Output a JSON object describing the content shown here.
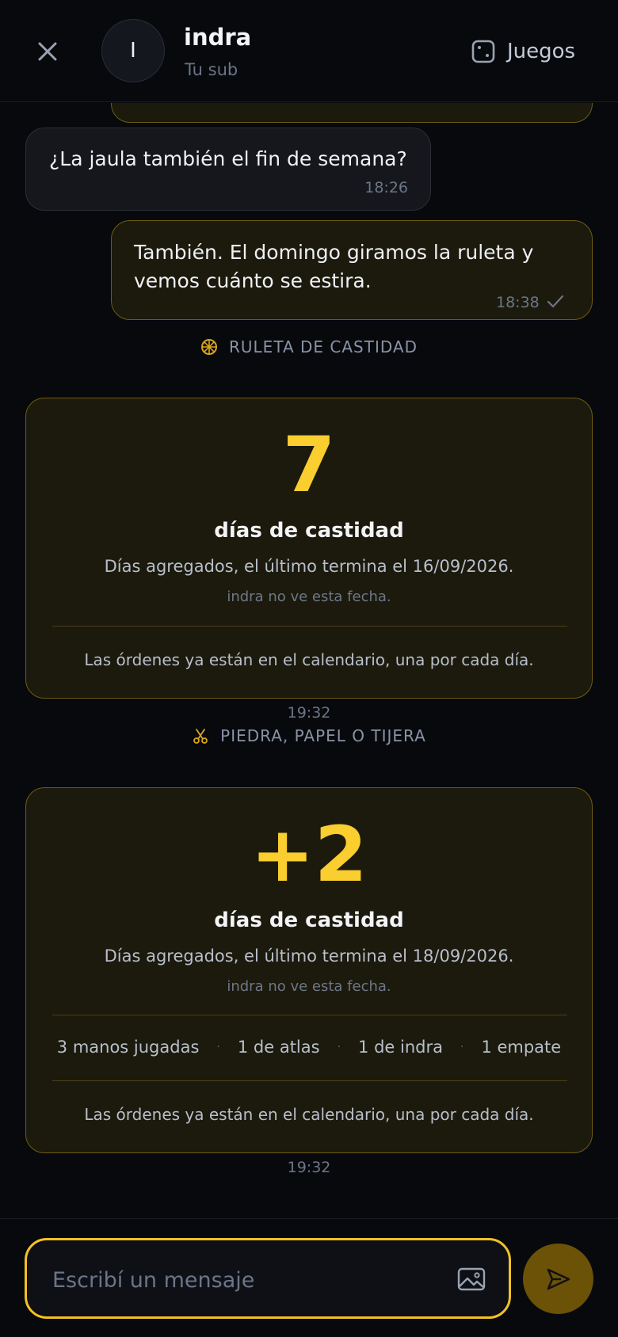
{
  "header": {
    "avatar_initial": "I",
    "name": "indra",
    "subtitle": "Tu sub",
    "games_label": "Juegos"
  },
  "messages": [
    {
      "direction": "incoming",
      "text": "¿La jaula también el fin de semana?",
      "time": "18:26"
    },
    {
      "direction": "outgoing",
      "text": "También. El domingo giramos la ruleta y vemos cuánto se estira.",
      "time": "18:38",
      "status": "sent"
    }
  ],
  "game_cards": [
    {
      "game_label": "RULETA DE CASTIDAD",
      "icon": "wheel-icon",
      "big_value": "7",
      "unit_title": "días de castidad",
      "description": "Días agregados, el último termina el 16/09/2026.",
      "note": "indra no ve esta fecha.",
      "footer": "Las órdenes ya están en el calendario, una por cada día.",
      "time": "19:32"
    },
    {
      "game_label": "PIEDRA, PAPEL O TIJERA",
      "icon": "scissors-icon",
      "big_value": "+2",
      "unit_title": "días de castidad",
      "description": "Días agregados, el último termina el 18/09/2026.",
      "note": "indra no ve esta fecha.",
      "stats": [
        "3 manos jugadas",
        "1 de atlas",
        "1 de indra",
        "1 empate"
      ],
      "footer": "Las órdenes ya están en el calendario, una por cada día.",
      "time": "19:32"
    }
  ],
  "composer": {
    "placeholder": "Escribí un mensaje"
  },
  "colors": {
    "accent": "#f9ce2e",
    "card_bg": "#1c1a0d",
    "card_border": "#6e5c13",
    "send_bg": "#6b5206",
    "page_bg": "#07090d"
  }
}
